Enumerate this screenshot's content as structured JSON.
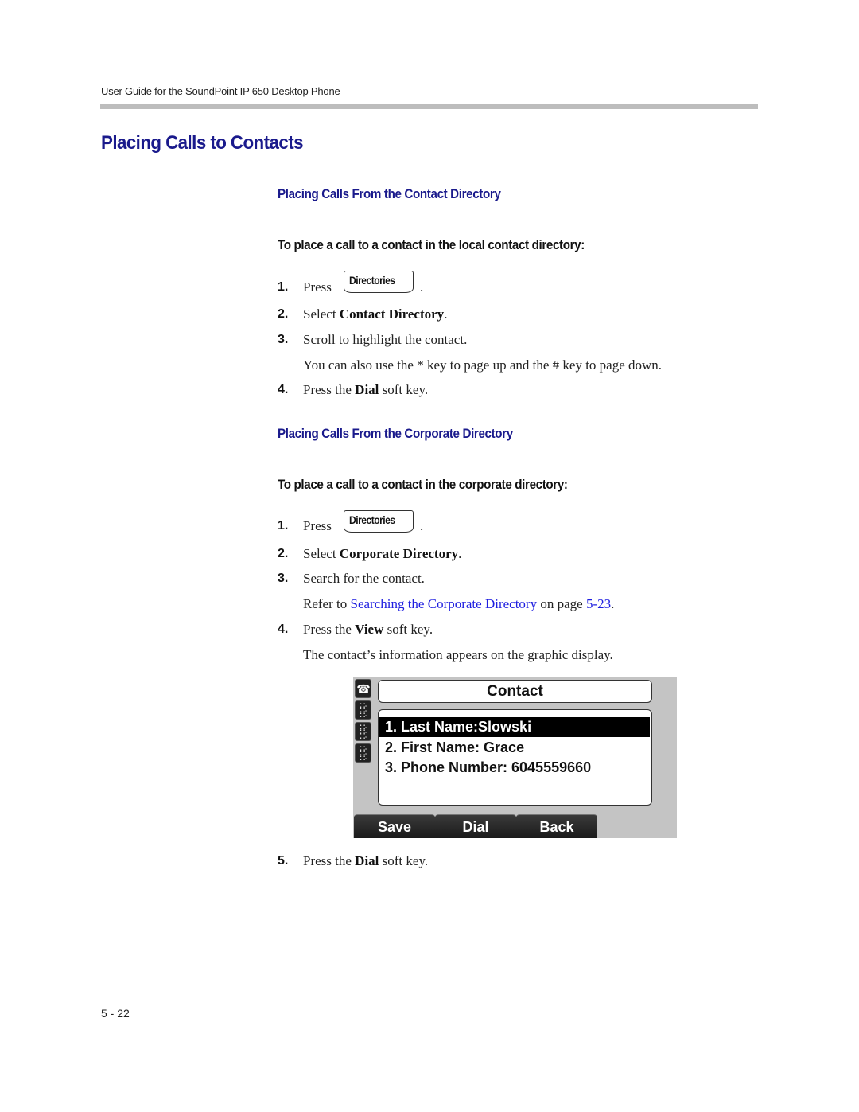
{
  "header": {
    "running_title": "User Guide for the SoundPoint IP 650 Desktop Phone",
    "page_number": "5 - 22"
  },
  "page_title": "Placing Calls to Contacts",
  "sections": [
    {
      "heading": "Placing Calls From the Contact Directory",
      "procedure_title": "To place a call to a contact in the local contact directory:",
      "steps": [
        {
          "num": "1.",
          "prefix": "Press",
          "key_label": "Directories",
          "suffix": "."
        },
        {
          "num": "2.",
          "prefix": "Select ",
          "bold": "Contact Directory",
          "suffix": "."
        },
        {
          "num": "3.",
          "text": "Scroll to highlight the contact.",
          "note": "You can also use the * key to page up and the # key to page down."
        },
        {
          "num": "4.",
          "prefix": "Press the ",
          "bold": "Dial",
          "suffix": " soft key."
        }
      ]
    },
    {
      "heading": "Placing Calls From the Corporate Directory",
      "procedure_title": "To place a call to a contact in the corporate directory:",
      "steps": [
        {
          "num": "1.",
          "prefix": "Press",
          "key_label": "Directories",
          "suffix": "."
        },
        {
          "num": "2.",
          "prefix": "Select ",
          "bold": "Corporate Directory",
          "suffix": "."
        },
        {
          "num": "3.",
          "text": "Search for the contact.",
          "note_prefix": "Refer to ",
          "note_link": "Searching the Corporate Directory",
          "note_mid": " on page ",
          "note_page_link": "5-23",
          "note_suffix": "."
        },
        {
          "num": "4.",
          "prefix": "Press the ",
          "bold": "View",
          "suffix": " soft key.",
          "note": "The contact’s information appears on the graphic display."
        },
        {
          "num": "5.",
          "prefix": "Press the ",
          "bold": "Dial",
          "suffix": " soft key."
        }
      ]
    }
  ],
  "phone_display": {
    "title": "Contact",
    "line_keys": [
      "phone-handset-icon",
      "keypad-icon",
      "keypad-icon",
      "keypad-icon"
    ],
    "rows": [
      {
        "text": "1. Last Name:Slowski",
        "selected": true
      },
      {
        "text": "2. First Name: Grace",
        "selected": false
      },
      {
        "text": "3. Phone Number: 6045559660",
        "selected": false
      }
    ],
    "softkeys": [
      "Save",
      "Dial",
      "Back"
    ]
  },
  "colors": {
    "heading_blue": "#1a1a8c",
    "link_blue": "#1f1fe0",
    "rule_gray": "#bdbdbd"
  }
}
